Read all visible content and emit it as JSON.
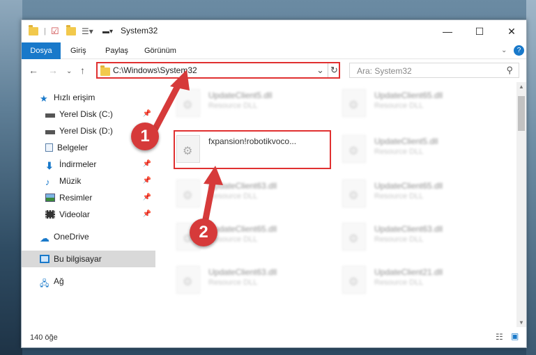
{
  "window": {
    "title": "System32"
  },
  "ribbon": {
    "tabs": [
      "Dosya",
      "Giriş",
      "Paylaş",
      "Görünüm"
    ]
  },
  "address": {
    "path": "C:\\Windows\\System32"
  },
  "search": {
    "placeholder": "Ara: System32"
  },
  "sidebar": {
    "items": [
      {
        "label": "Hızlı erişim",
        "icon": "star-icon"
      },
      {
        "label": "Yerel Disk (C:)",
        "icon": "drive-icon",
        "pinned": true
      },
      {
        "label": "Yerel Disk (D:)",
        "icon": "drive-icon"
      },
      {
        "label": "Belgeler",
        "icon": "document-icon"
      },
      {
        "label": "İndirmeler",
        "icon": "download-icon",
        "pinned": true
      },
      {
        "label": "Müzik",
        "icon": "music-icon",
        "pinned": true
      },
      {
        "label": "Resimler",
        "icon": "pictures-icon",
        "pinned": true
      },
      {
        "label": "Videolar",
        "icon": "videos-icon",
        "pinned": true
      },
      {
        "label": "OneDrive",
        "icon": "cloud-icon"
      },
      {
        "label": "Bu bilgisayar",
        "icon": "computer-icon",
        "selected": true
      },
      {
        "label": "Ağ",
        "icon": "network-icon"
      }
    ]
  },
  "files": [
    {
      "name": "UpdateClient5.dll",
      "type": "Resource DLL"
    },
    {
      "name": "UpdateClient65.dll",
      "type": "Resource DLL"
    },
    {
      "name": "fxpansion!robotikvoco...",
      "type": ""
    },
    {
      "name": "UpdateClient5.dll",
      "type": "Resource DLL"
    },
    {
      "name": "UpdateClient63.dll",
      "type": "Resource DLL"
    },
    {
      "name": "UpdateClient65.dll",
      "type": "Resource DLL"
    },
    {
      "name": "UpdateClient65.dll",
      "type": "Resource DLL"
    },
    {
      "name": "UpdateClient63.dll",
      "type": "Resource DLL"
    },
    {
      "name": "UpdateClient63.dll",
      "type": "Resource DLL"
    },
    {
      "name": "UpdateClient21.dll",
      "type": "Resource DLL"
    }
  ],
  "status": {
    "count": "140 öğe"
  },
  "annotations": {
    "step1": "1",
    "step2": "2"
  },
  "colors": {
    "accent": "#1979ca",
    "highlight": "#e03030",
    "badge": "#d63a3a"
  }
}
